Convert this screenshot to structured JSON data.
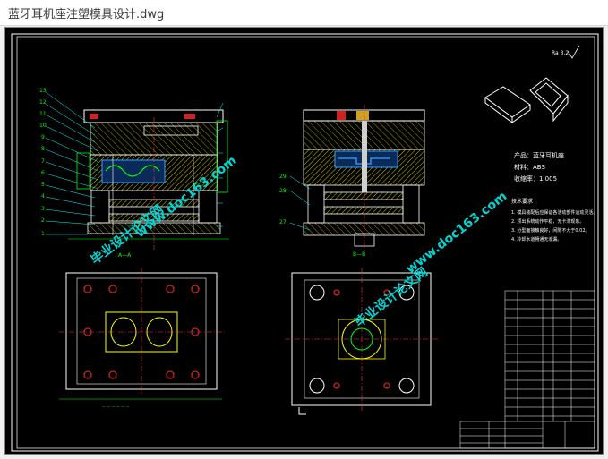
{
  "window": {
    "title": "蓝牙耳机座注塑模具设计.dwg"
  },
  "drawing": {
    "section_a_label": "A—A",
    "section_b_label": "B—B",
    "roughness": "Ra 3.2",
    "product_name": "产品：蓝牙耳机座",
    "material": "材料：ABS",
    "shrinkage": "收缩率：1.005",
    "tech_req_title": "技术要求",
    "tech_req_lines": [
      "1. 模具装配后应保证各活动部件运动灵活。",
      "2. 顶出系统动作平稳，无卡滞现象。",
      "3. 分型面接触良好，间隙不大于0.02。",
      "4. 冷却水道畅通无渗漏。"
    ],
    "watermark_url": "www.doc163.com",
    "watermark_cn": "毕业设计论文网",
    "part_numbers_a": [
      "13",
      "12",
      "11",
      "10",
      "9",
      "8",
      "7",
      "6",
      "5",
      "4",
      "3",
      "2",
      "1"
    ],
    "part_numbers_b": [
      "29",
      "28",
      "27"
    ]
  },
  "colors": {
    "background": "#000000",
    "outline": "#ffffff",
    "centerline": "#ff3030",
    "dimension": "#00ff00",
    "hatch": "#ffff00",
    "leader": "#00ffff",
    "watermark": "#00d4d4"
  }
}
